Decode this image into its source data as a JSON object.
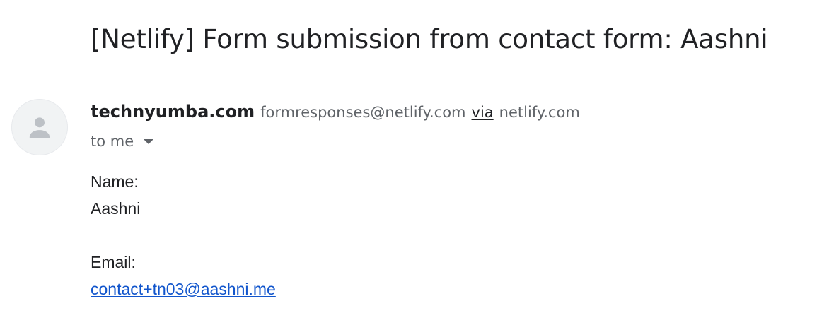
{
  "email": {
    "subject": "[Netlify] Form submission from contact form: Aashni",
    "sender": {
      "name": "technyumba.com",
      "address": "formresponses@netlify.com",
      "via_label": "via",
      "via_domain": "netlify.com"
    },
    "recipient_label": "to me",
    "body": {
      "name_label": "Name:",
      "name_value": "Aashni",
      "email_label": "Email:",
      "email_value": "contact+tn03@aashni.me"
    }
  },
  "colors": {
    "link": "#1155cc",
    "secondary_text": "#5f6368",
    "avatar_bg": "#f1f3f4",
    "avatar_icon": "#bdc1c6"
  },
  "icons": {
    "avatar": "person-icon",
    "recipient_caret": "caret-down-icon"
  }
}
